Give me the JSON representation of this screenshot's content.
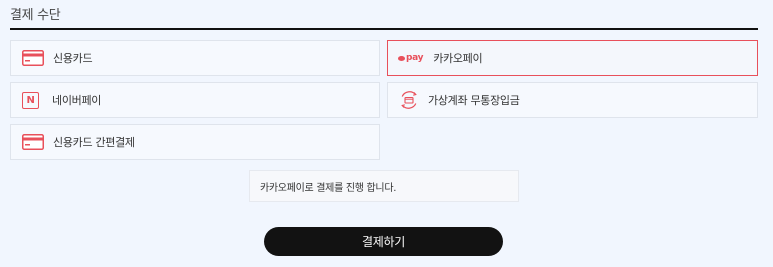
{
  "section": {
    "title": "결제 수단"
  },
  "methods": {
    "credit_card": {
      "label": "신용카드",
      "icon": "credit-card-icon"
    },
    "kakaopay": {
      "label": "카카오페이",
      "logo_text": "pay",
      "icon": "kakaopay-logo-icon",
      "selected": true
    },
    "naverpay": {
      "label": "네이버페이",
      "logo_text": "N",
      "icon": "naver-logo-icon"
    },
    "virtual_account": {
      "label": "가상계좌 무통장입금",
      "icon": "bank-transfer-icon"
    },
    "easy_card": {
      "label": "신용카드 간편결제",
      "icon": "credit-card-icon"
    }
  },
  "notice": {
    "text": "카카오페이로 결제를 진행 합니다."
  },
  "submit": {
    "label": "결제하기"
  },
  "colors": {
    "accent": "#e8505b",
    "background": "#f1f6fe",
    "button": "#121212",
    "divider": "#111111"
  }
}
